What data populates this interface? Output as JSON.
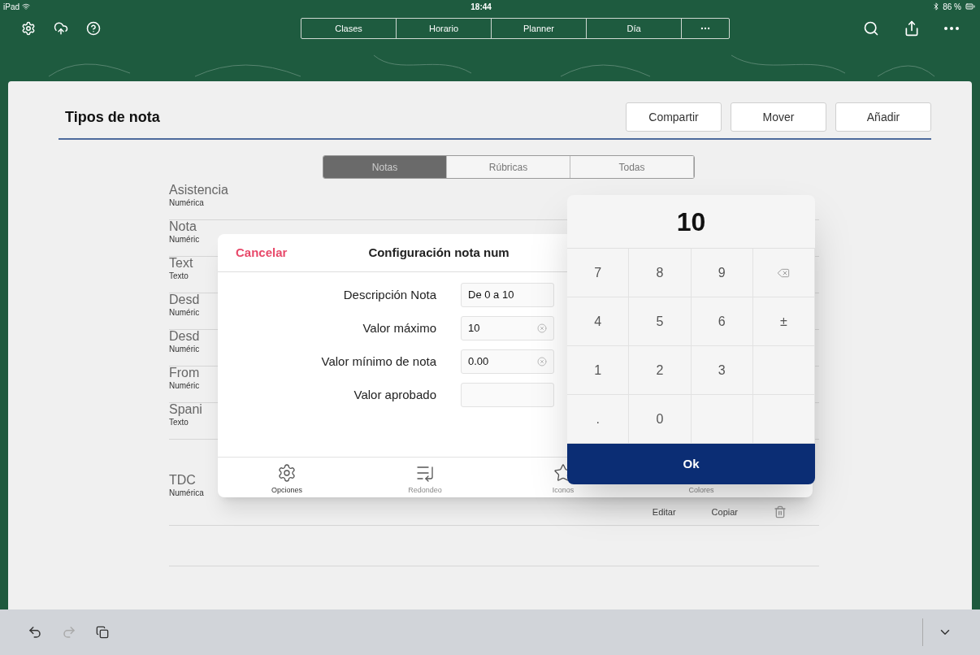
{
  "status_bar": {
    "device": "iPad",
    "time": "18:44",
    "battery": "86 %"
  },
  "toolbar": {
    "segments": [
      {
        "label": "Clases",
        "selected": false
      },
      {
        "label": "Horario",
        "selected": false
      },
      {
        "label": "Planner",
        "selected": false
      },
      {
        "label": "Día",
        "selected": false
      }
    ]
  },
  "page": {
    "title": "Tipos de nota",
    "actions": [
      "Compartir",
      "Mover",
      "Añadir"
    ],
    "filter_tabs": [
      {
        "label": "Notas",
        "selected": true
      },
      {
        "label": "Rúbricas",
        "selected": false
      },
      {
        "label": "Todas",
        "selected": false
      }
    ],
    "note_types": [
      {
        "name": "Asistencia",
        "type": "Numérica"
      },
      {
        "name": "Nota",
        "type": "Numéric"
      },
      {
        "name": "Text",
        "type": "Texto"
      },
      {
        "name": "Desd",
        "type": "Numéric"
      },
      {
        "name": "Desd",
        "type": "Numéric"
      },
      {
        "name": "From",
        "type": "Numéric"
      },
      {
        "name": "Spani",
        "type": "Texto"
      },
      {
        "name": "TDC",
        "type": "Numérica",
        "actions": [
          "Editar",
          "Copiar"
        ]
      }
    ]
  },
  "dialog": {
    "cancel": "Cancelar",
    "title": "Configuración nota num",
    "fields": [
      {
        "label": "Descripción Nota",
        "value": "De 0 a 10",
        "clearable": false
      },
      {
        "label": "Valor máximo",
        "value": "10",
        "clearable": true
      },
      {
        "label": "Valor mínimo de nota",
        "value": "0.00",
        "clearable": true
      },
      {
        "label": "Valor aprobado",
        "clearable": false
      }
    ],
    "tabs": [
      {
        "label": "Opciones",
        "selected": true
      },
      {
        "label": "Redondeo",
        "selected": false
      },
      {
        "label": "Iconos",
        "selected": false
      },
      {
        "label": "Colores",
        "selected": false
      }
    ]
  },
  "keypad": {
    "display": "10",
    "keys": [
      {
        "kind": "key",
        "label": "7"
      },
      {
        "kind": "key",
        "label": "8"
      },
      {
        "kind": "key",
        "label": "9"
      },
      {
        "kind": "backspace"
      },
      {
        "kind": "key",
        "label": "4"
      },
      {
        "kind": "key",
        "label": "5"
      },
      {
        "kind": "key",
        "label": "6"
      },
      {
        "kind": "key",
        "label": "±"
      },
      {
        "kind": "key",
        "label": "1"
      },
      {
        "kind": "key",
        "label": "2"
      },
      {
        "kind": "key",
        "label": "3"
      },
      {
        "kind": "blank"
      },
      {
        "kind": "key",
        "label": "."
      },
      {
        "kind": "key",
        "label": "0"
      },
      {
        "kind": "blank"
      },
      {
        "kind": "blank"
      }
    ],
    "ok": "Ok"
  }
}
